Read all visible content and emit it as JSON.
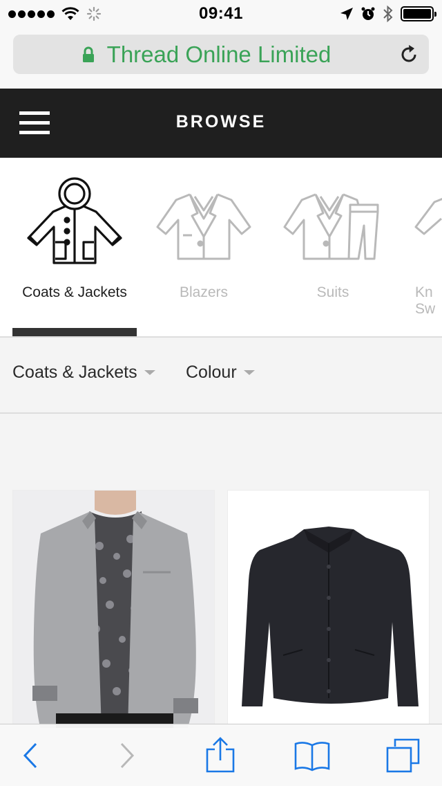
{
  "status_bar": {
    "time": "09:41",
    "icons": [
      "signal-dots-icon",
      "wifi-icon",
      "activity-spinner-icon",
      "location-arrow-icon",
      "alarm-icon",
      "bluetooth-icon",
      "battery-icon"
    ],
    "battery_level": 1.0
  },
  "browser": {
    "address_text": "Thread Online Limited",
    "secure": true,
    "lock_color": "#3aa357"
  },
  "header": {
    "title": "BROWSE",
    "background": "#1f1f1f"
  },
  "categories": [
    {
      "label": "Coats & Jackets",
      "icon": "coat-icon",
      "active": true
    },
    {
      "label": "Blazers",
      "icon": "blazer-icon",
      "active": false
    },
    {
      "label": "Suits",
      "icon": "suit-icon",
      "active": false
    },
    {
      "label": "Kn Sw",
      "icon": "knitwear-icon",
      "active": false
    }
  ],
  "filters": [
    {
      "label": "Coats & Jackets"
    },
    {
      "label": "Colour"
    }
  ],
  "products": [
    {
      "image": "grey-bomber-jacket-photo"
    },
    {
      "image": "black-coach-jacket-photo"
    }
  ],
  "toolbar": {
    "buttons": [
      "back-icon",
      "forward-icon",
      "share-icon",
      "bookmarks-icon",
      "tabs-icon"
    ],
    "accent": "#1a78e6"
  }
}
